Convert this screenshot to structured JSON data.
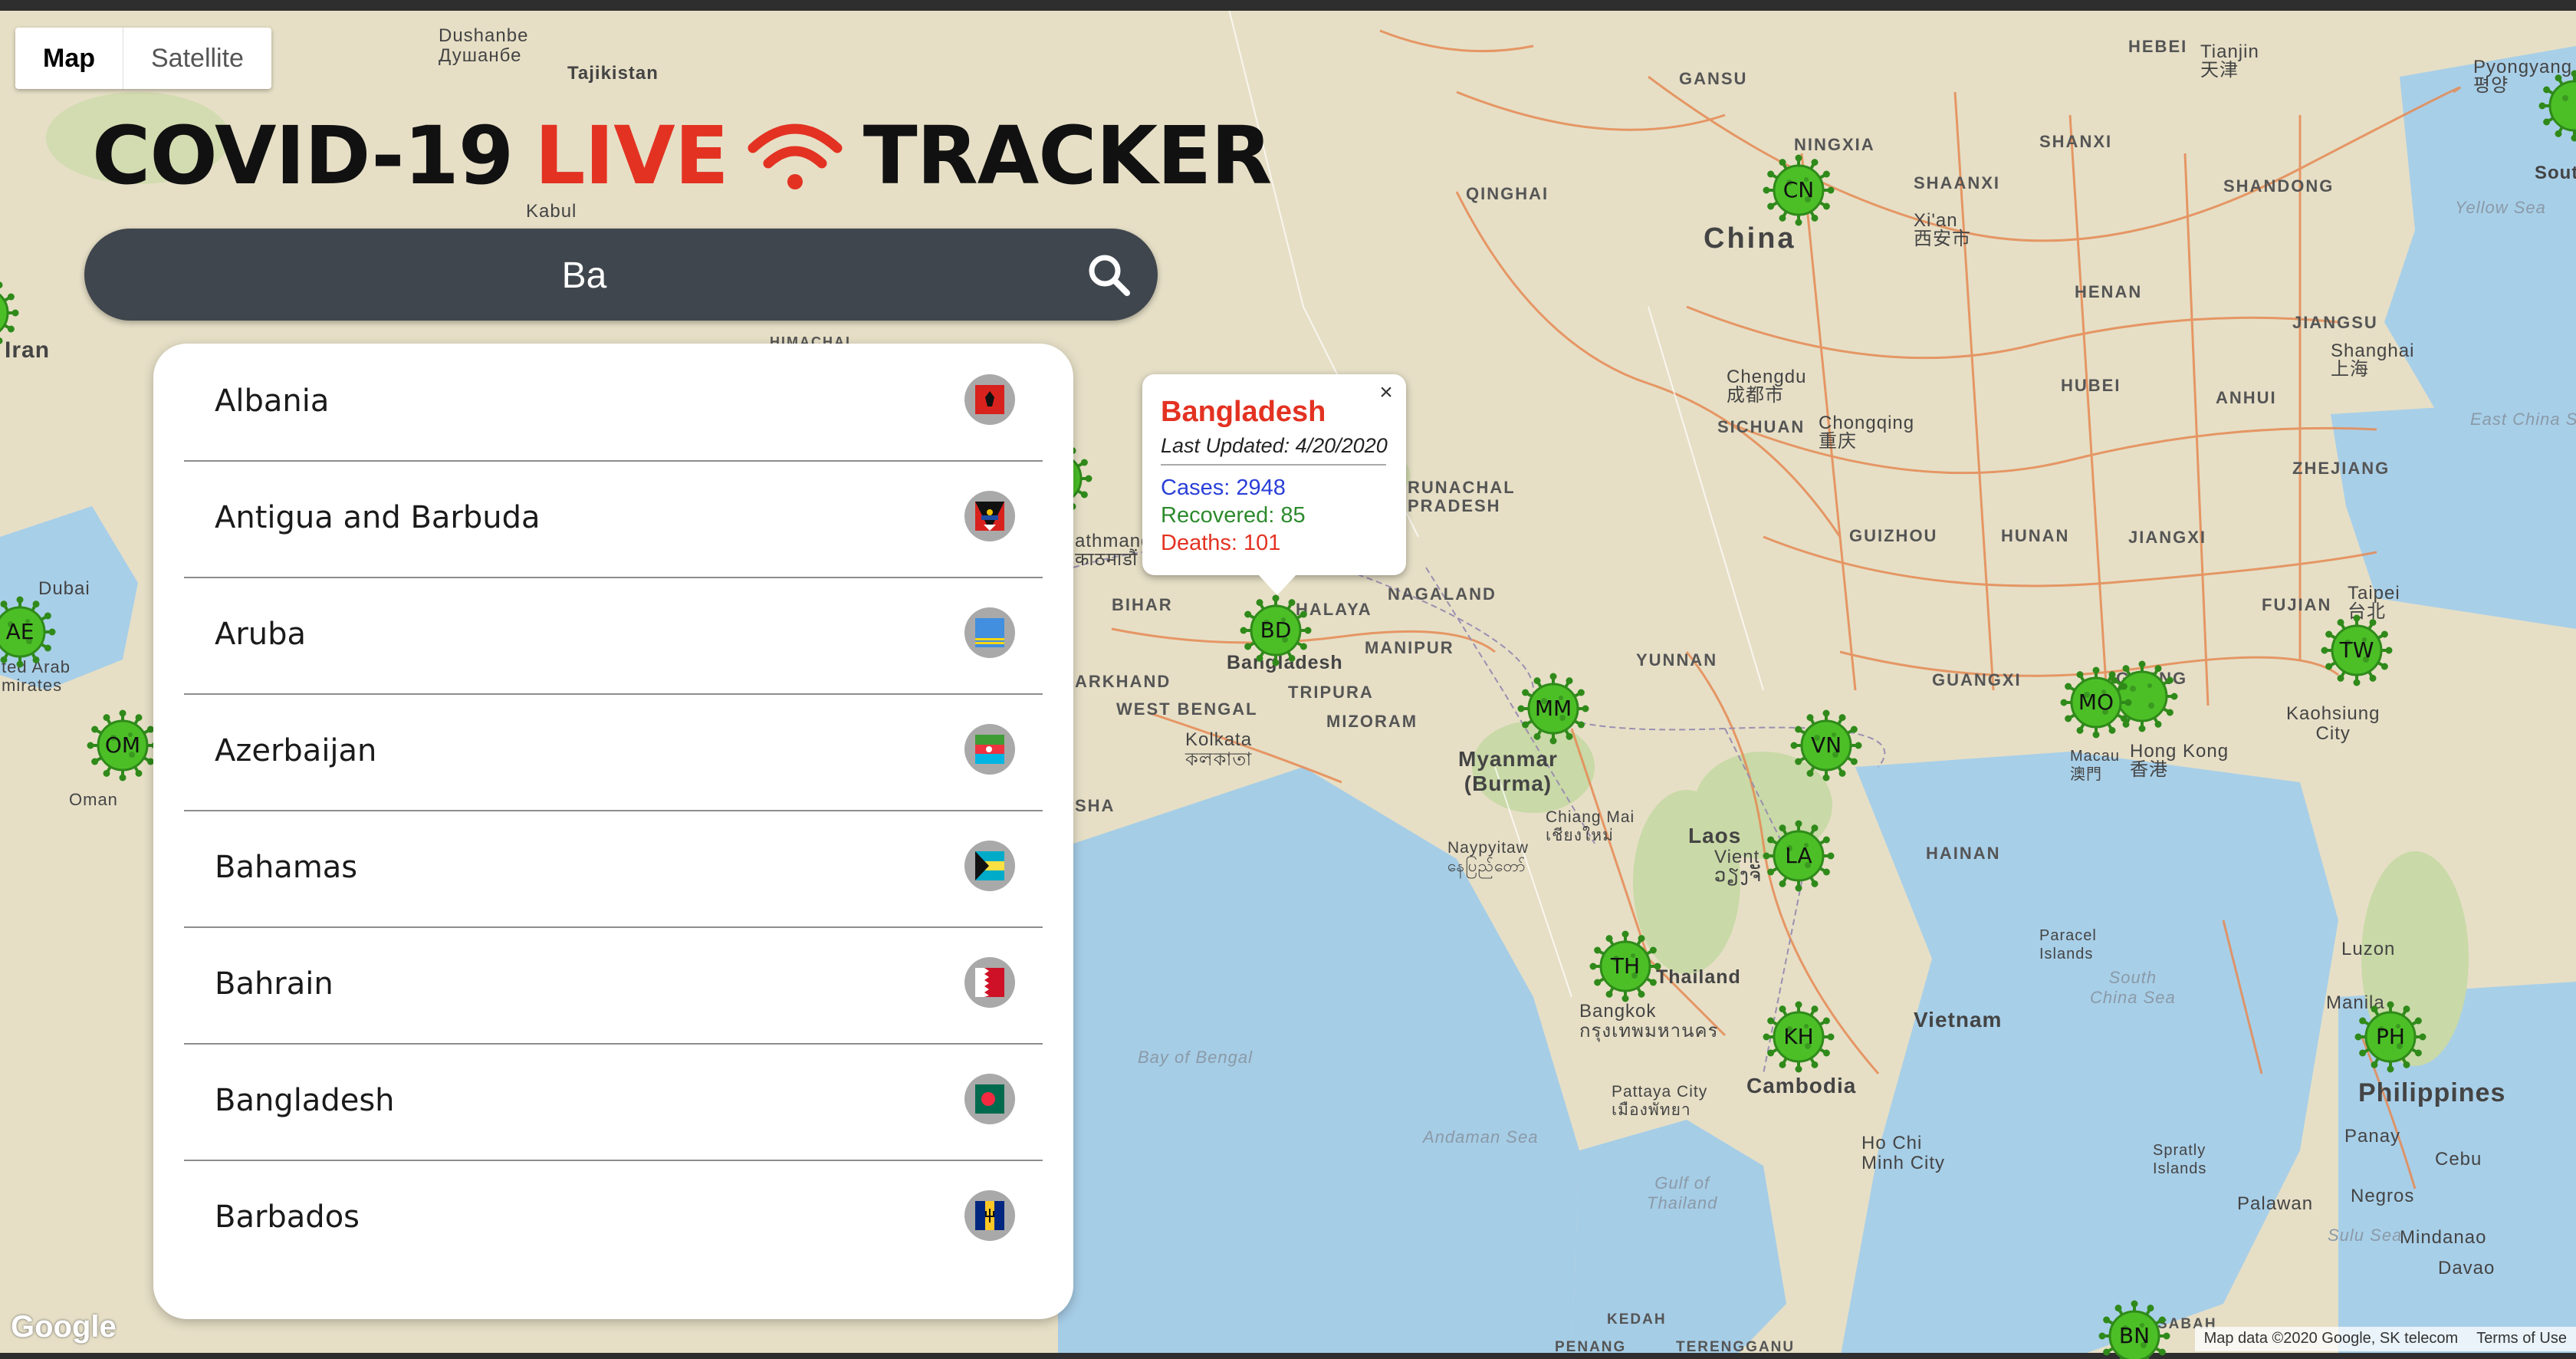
{
  "map_type": {
    "map_label": "Map",
    "satellite_label": "Satellite",
    "selected": "Map"
  },
  "title": {
    "part1": "COVID-19",
    "part2": "LIVE",
    "part3": "TRACKER",
    "accent_color": "#e33222"
  },
  "search": {
    "value": "Ba",
    "icon": "search-icon"
  },
  "results": [
    {
      "name": "Albania",
      "flag": "albania-flag-icon"
    },
    {
      "name": "Antigua and Barbuda",
      "flag": "antigua-barbuda-flag-icon"
    },
    {
      "name": "Aruba",
      "flag": "aruba-flag-icon"
    },
    {
      "name": "Azerbaijan",
      "flag": "azerbaijan-flag-icon"
    },
    {
      "name": "Bahamas",
      "flag": "bahamas-flag-icon"
    },
    {
      "name": "Bahrain",
      "flag": "bahrain-flag-icon"
    },
    {
      "name": "Bangladesh",
      "flag": "bangladesh-flag-icon"
    },
    {
      "name": "Barbados",
      "flag": "barbados-flag-icon"
    }
  ],
  "info_window": {
    "country": "Bangladesh",
    "last_updated": "Last Updated: 4/20/2020",
    "cases": "Cases: 2948",
    "recovered": "Recovered: 85",
    "deaths": "Deaths: 101",
    "close": "×"
  },
  "markers": [
    "CN",
    "BD",
    "MM",
    "VN",
    "LA",
    "TH",
    "KH",
    "MO",
    "TW",
    "PH",
    "BN",
    "AE",
    "OM"
  ],
  "map_labels": {
    "china": "China",
    "myanmar": "Myanmar\n(Burma)",
    "laos": "Laos",
    "vietnam": "Vietnam",
    "cambodia": "Cambodia",
    "philippines": "Philippines",
    "bangladesh": "Bangladesh",
    "thailand": "Thailand",
    "iran": "Iran",
    "oman": "Oman",
    "uae": "ted Arab\nmirates",
    "dubai": "Dubai",
    "kabul": "Kabul",
    "tajikistan": "Tajikistan",
    "dushanbe": "Dushanbe\nДушанбе",
    "gansu": "GANSU",
    "qinghai": "QINGHAI",
    "ningxia": "NINGXIA",
    "shanxi": "SHANXI",
    "shaanxi": "SHAANXI",
    "henan": "HENAN",
    "shandong": "SHANDONG",
    "jiangsu": "JIANGSU",
    "hubei": "HUBEI",
    "anhui": "ANHUI",
    "sichuan": "SICHUAN",
    "zhejiang": "ZHEJIANG",
    "guizhou": "GUIZHOU",
    "hunan": "HUNAN",
    "jiangxi": "JIANGXI",
    "fujian": "FUJIAN",
    "guangxi": "GUANGXI",
    "guangdong": "GDONG",
    "yunnan": "YUNNAN",
    "hainan": "HAINAN",
    "hebei": "HEBEI",
    "tianjin": "Tianjin\n天津",
    "pyongyang": "Pyongyang\n평양",
    "xian": "Xi'an\n西安市",
    "chengdu": "Chengdu\n成都市",
    "chongqing": "Chongqing\n重庆",
    "shanghai": "Shanghai\n上海",
    "taipei": "Taipei\n台北",
    "kaohsiung": "Kaohsiung\nCity",
    "hongkong": "Hong Kong\n香港",
    "macau": "Macau\n澳門",
    "bangkok": "Bangkok\nกรุงเทพมหานคร",
    "pattaya": "Pattaya City\nเมืองพัทยา",
    "hochiminh": "Ho Chi\nMinh City",
    "chiangmai": "Chiang Mai\nเชียงใหม่",
    "naypyitaw": "Naypyitaw\nနေပြည်တော်",
    "kolkata": "Kolkata\nকলকাতা",
    "bihar": "BIHAR",
    "jharkhand": "ARKHAND",
    "westbengal": "WEST BENGAL",
    "tripura": "TRIPURA",
    "mizoram": "MIZORAM",
    "manipur": "MANIPUR",
    "nagaland": "NAGALAND",
    "arunachal": "RUNACHAL\nPRADESH",
    "meghalaya": "HALAYA",
    "himachal": "HIMACHAL",
    "kathmandu": "athmand\nकाठमाडौं",
    "yellowsea": "Yellow Sea",
    "eastchinasea": "East China Se",
    "southchinasea": "South\nChina Sea",
    "bayofbengal": "Bay of Bengal",
    "andamansea": "Andaman Sea",
    "gulfthailand": "Gulf of\nThailand",
    "sulusea": "Sulu Sea",
    "paracel": "Paracel\nIslands",
    "spratly": "Spratly\nIslands",
    "luzon": "Luzon",
    "manila": "Manila",
    "panay": "Panay",
    "cebu": "Cebu",
    "negros": "Negros",
    "palawan": "Palawan",
    "mindanao": "Mindanao",
    "davao": "Davao",
    "kedah": "KEDAH",
    "penang": "PENANG",
    "terengganu": "TERENGGANU",
    "sabah": "SABAH",
    "south": "Sout",
    "vientiane": "Vient\nວຽງຈັ",
    "odisha": "SHA"
  },
  "attribution": {
    "data": "Map data ©2020 Google, SK telecom",
    "terms": "Terms of Use",
    "logo": "Google"
  },
  "colors": {
    "search_bg": "#3f464d",
    "virus_green": "#4cbf27",
    "road": "#e58a54"
  }
}
